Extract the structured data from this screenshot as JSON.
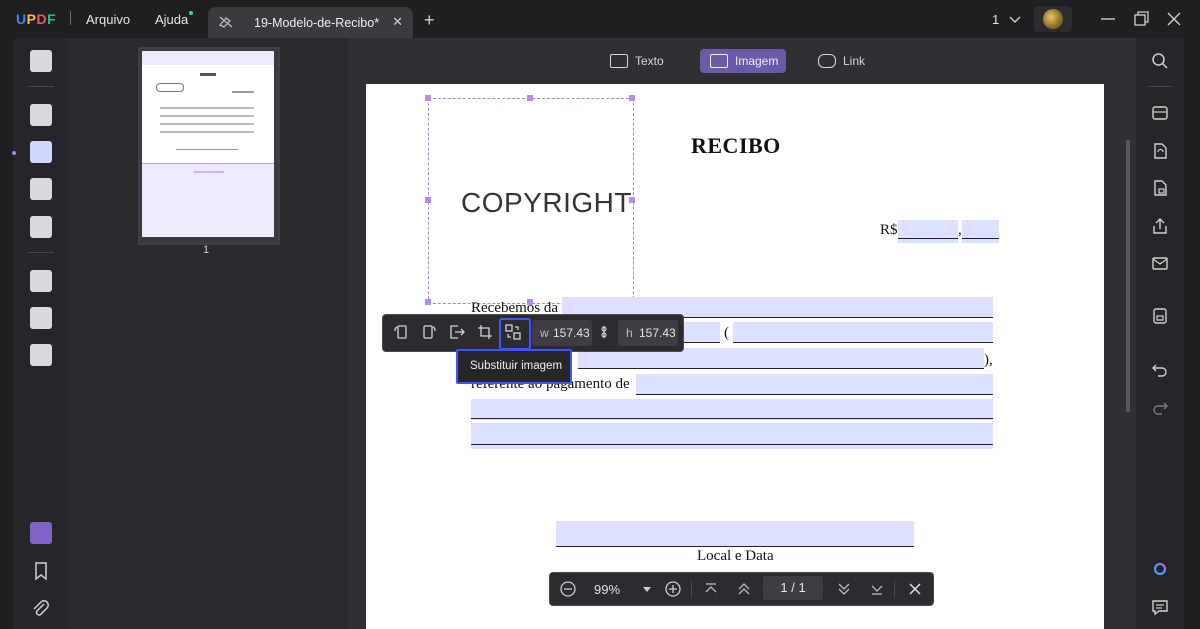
{
  "app": {
    "logo": "UPDF",
    "menu": [
      {
        "label": "Arquivo"
      },
      {
        "label": "Ajuda"
      }
    ]
  },
  "tab": {
    "title": "19-Modelo-de-Recibo*"
  },
  "titlebar": {
    "page_selector": "1",
    "icons": [
      "new-tab-icon",
      "avatar",
      "minimize-icon",
      "restore-icon",
      "close-icon"
    ]
  },
  "left_tools": [
    "reader-icon",
    "comment-icon",
    "edit-pdf-icon",
    "form-icon",
    "organize-icon",
    "page-tools-icon",
    "convert-icon",
    "ocr-tools-icon",
    "layers-icon",
    "bookmark-icon",
    "attachment-icon"
  ],
  "thumbnail": {
    "page_number": "1"
  },
  "modes": {
    "text": "Texto",
    "image": "Imagem",
    "link": "Link",
    "selected": "Imagem"
  },
  "document": {
    "title": "RECIBO",
    "currency_label": "R$",
    "comma": ",",
    "received_from": "Recebemos da",
    "paren_open": "(",
    "paren_close": "),",
    "referring_to": "referente ao pagamento de",
    "place_date": "Local e Data",
    "image_text": "COPYRIGHT"
  },
  "image_toolbar": {
    "width_label": "w",
    "width_value": "157.43",
    "height_label": "h",
    "height_value": "157.43",
    "tooltip": "Substituir imagem"
  },
  "zoom_bar": {
    "zoom": "99%",
    "page": "1",
    "page_sep": "/",
    "total_pages": "1"
  },
  "right_tools": [
    "search-icon",
    "ocr-icon",
    "convert-icon",
    "protect-icon",
    "share-icon",
    "email-icon",
    "save-icon",
    "undo-icon",
    "redo-icon",
    "ai-assistant-icon",
    "comment-panel-icon"
  ],
  "colors": {
    "accent": "#6b5aa8",
    "selection": "#3b57ff",
    "field_fill": "#dde0ff"
  }
}
